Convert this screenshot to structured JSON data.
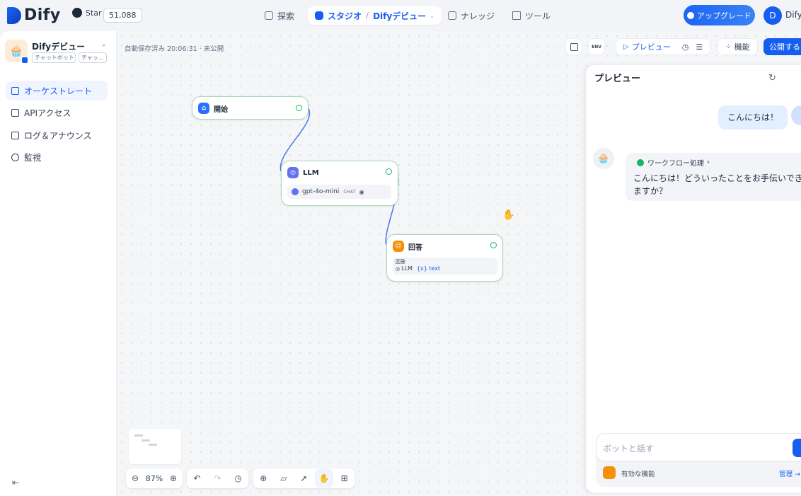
{
  "header": {
    "logo_text": "Dify",
    "github_label": "Star",
    "github_count": "51,088",
    "nav": {
      "explore": "探索",
      "studio": "スタジオ",
      "app_name": "Difyデビュー",
      "knowledge": "ナレッジ",
      "tools": "ツール"
    },
    "upgrade_label": "アップグレード",
    "avatar_initial": "D",
    "user_name": "Dify"
  },
  "sidebar": {
    "app_name": "Difyデビュー",
    "tags": [
      "チャットボット",
      "チャッ..."
    ],
    "items": [
      {
        "label": "オーケストレート",
        "icon": "layout-icon",
        "active": true
      },
      {
        "label": "APIアクセス",
        "icon": "terminal-icon",
        "active": false
      },
      {
        "label": "ログ＆アナウンス",
        "icon": "file-list-icon",
        "active": false
      },
      {
        "label": "監視",
        "icon": "monitor-icon",
        "active": false
      }
    ]
  },
  "toolbar": {
    "autosave": "自動保存済み 20:06:31 · 未公開",
    "env_label": "ENV",
    "preview_label": "プレビュー",
    "features_label": "機能",
    "publish_label": "公開する"
  },
  "workflow": {
    "nodes": {
      "start": {
        "title": "開始"
      },
      "llm": {
        "title": "LLM",
        "model": "gpt-4o-mini",
        "mode": "CHAT"
      },
      "answer": {
        "title": "回答",
        "field_label": "回答",
        "ref_node": "LLM",
        "ref_var": "text"
      }
    },
    "zoom": "87%"
  },
  "preview": {
    "title": "プレビュー",
    "user_message": "こんにちは！",
    "workflow_label": "ワークフロー処理",
    "bot_message": "こんにちは！どういったことをお手伝いできますか？",
    "input_placeholder": "ボットと話す",
    "features_label": "有効な機能",
    "manage_label": "管理 →"
  },
  "colors": {
    "accent": "#155eef",
    "node_border_success": "#a7d8b8",
    "answer_node": "#f79009",
    "llm_node": "#6172f3"
  }
}
